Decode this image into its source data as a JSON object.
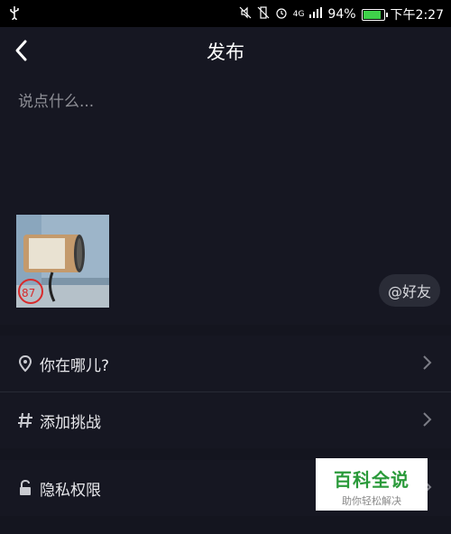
{
  "status_bar": {
    "network": "4G",
    "battery_percent": "94%",
    "battery_level": 0.94,
    "time": "下午2:27"
  },
  "header": {
    "title": "发布"
  },
  "compose": {
    "placeholder": "说点什么...",
    "thumb_badge": "87",
    "at_friend_label": "@好友"
  },
  "rows": [
    {
      "label": "你在哪儿?",
      "icon": "location-icon"
    },
    {
      "label": "添加挑战",
      "icon": "hashtag-icon"
    },
    {
      "label": "隐私权限",
      "icon": "lock-icon"
    }
  ],
  "watermark": {
    "title": "百科全说",
    "subtitle": "助你轻松解决"
  },
  "colors": {
    "background": "#14151f",
    "panel": "#161722",
    "accent_battery": "#3fd14a",
    "watermark_green": "#2a9a3a"
  }
}
